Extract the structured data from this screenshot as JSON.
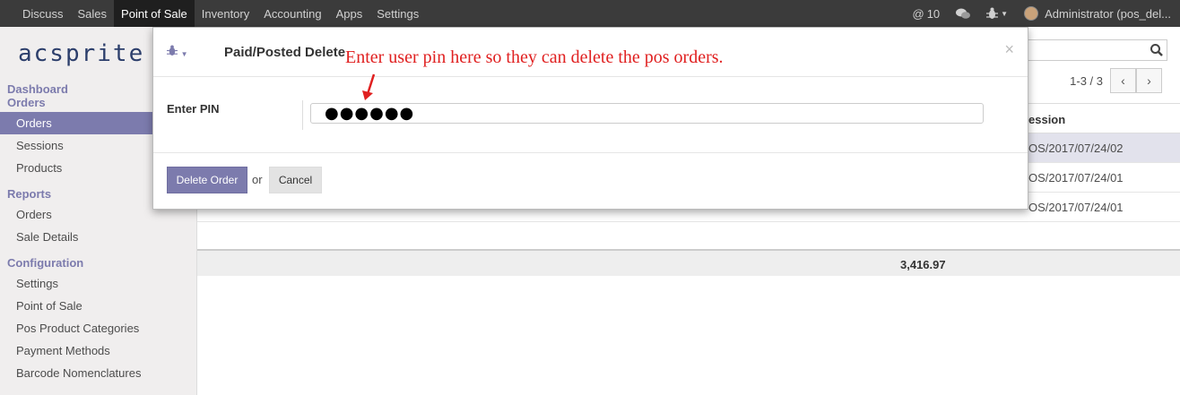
{
  "topbar": {
    "menu": [
      "Discuss",
      "Sales",
      "Point of Sale",
      "Inventory",
      "Accounting",
      "Apps",
      "Settings"
    ],
    "active_index": 2,
    "messages_count": "10",
    "user": "Administrator (pos_del..."
  },
  "sidebar": {
    "logo": "acsprite",
    "sections": [
      {
        "title": "Dashboard",
        "items": []
      },
      {
        "title": "Orders",
        "items": [
          "Orders",
          "Sessions",
          "Products"
        ]
      },
      {
        "title": "Reports",
        "items": [
          "Orders",
          "Sale Details"
        ]
      },
      {
        "title": "Configuration",
        "items": [
          "Settings",
          "Point of Sale",
          "Pos Product Categories",
          "Payment Methods",
          "Barcode Nomenclatures"
        ]
      }
    ],
    "active_item": "Orders"
  },
  "main": {
    "pager": "1-3 / 3",
    "column_header": "ession",
    "rows": [
      {
        "session": "OS/2017/07/24/02"
      },
      {
        "session": "OS/2017/07/24/01"
      },
      {
        "session": "OS/2017/07/24/01"
      }
    ],
    "total": "3,416.97"
  },
  "modal": {
    "title": "Paid/Posted Delete",
    "annotation": "Enter user pin here so they can delete the pos orders.",
    "pin_label": "Enter PIN",
    "pin_value": "●●●●●●",
    "delete_label": "Delete Order",
    "or_label": "or",
    "cancel_label": "Cancel",
    "close_glyph": "×"
  }
}
